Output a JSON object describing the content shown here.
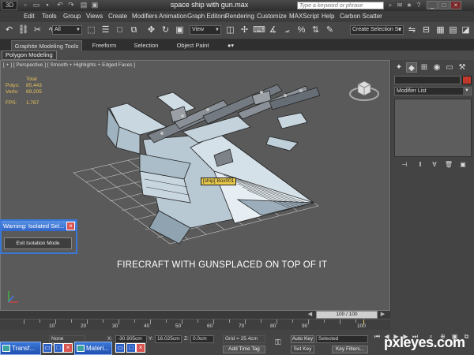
{
  "window": {
    "title": "space ship with gun.max",
    "search_placeholder": "Type a keyword or phrase",
    "app_logo": "3D"
  },
  "menu": [
    "Edit",
    "Tools",
    "Group",
    "Views",
    "Create",
    "Modifiers",
    "Animation",
    "Graph Editors",
    "Rendering",
    "Customize",
    "MAXScript",
    "Help",
    "Carbon Scatter"
  ],
  "toolbar": {
    "selection_filter": "All",
    "reference_coord": "View",
    "named_selection": "Create Selection Se"
  },
  "ribbon": {
    "tabs": [
      "Graphite Modeling Tools",
      "Freeform",
      "Selection",
      "Object Paint"
    ],
    "panel_label": "Polygon Modeling"
  },
  "viewport": {
    "label": "[ + ] [ Perspective ] [ Smooth + Highlights + Edged Faces ]",
    "stats": {
      "header": "Total",
      "polys_label": "Polys:",
      "polys_value": "85,443",
      "verts_label": "Verts:",
      "verts_value": "69,205",
      "fps_label": "FPS:",
      "fps_value": "1.767"
    },
    "object_tag": "[ship] Box001",
    "caption": "FIRECRAFT WITH GUNSPLACED ON TOP OF IT"
  },
  "warning_dialog": {
    "title": "Warning: Isolated Sel...",
    "button": "Exit Isolation Mode"
  },
  "command_panel": {
    "modifier_list": "Modifier List",
    "color": "#c0392b"
  },
  "time": {
    "slider_label": "100 / 100",
    "ticks": [
      "10",
      "20",
      "30",
      "40",
      "50",
      "60",
      "70",
      "80",
      "90",
      "100"
    ]
  },
  "status": {
    "selection": "None Selected",
    "x_label": "X:",
    "x_value": "-30.905cm",
    "y_label": "Y:",
    "y_value": "16.025cm",
    "z_label": "Z:",
    "z_value": "0.0cm",
    "grid": "Grid = 25.4cm",
    "add_time_tag": "Add Time Tag",
    "auto_key": "Auto Key",
    "set_key": "Set Key",
    "key_mode": "Selected",
    "key_filters": "Key Filters..."
  },
  "taskbar": [
    {
      "label": "Transf..."
    },
    {
      "label": "Materi..."
    }
  ],
  "watermark": "pxleyes.com"
}
